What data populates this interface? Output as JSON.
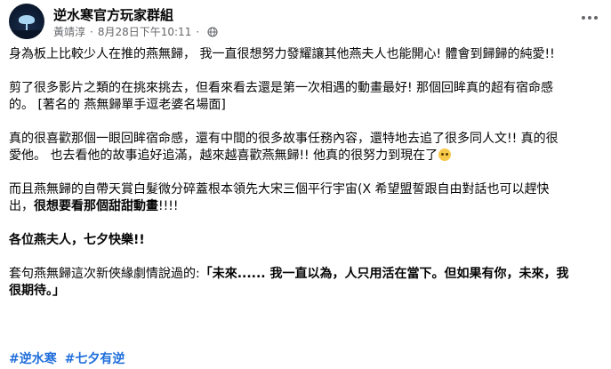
{
  "header": {
    "group_name": "逆水寒官方玩家群組",
    "author": "黃靖淳",
    "separator": "·",
    "timestamp": "8月28日下午10:11",
    "privacy_icon": "globe-icon",
    "more_icon": "more-horizontal-icon"
  },
  "post": {
    "p1": "身為板上比較少人在推的燕無歸， 我一直很想努力發耀讓其他燕夫人也能開心! 體會到歸歸的純愛!!",
    "p2_line1": "剪了很多影片之類的在挑來挑去，但看來看去還是第一次相遇的動畫最好! 那個回眸真的超有宿命感",
    "p2_line2": "的。 [著名的 燕無歸單手逗老婆名場面]",
    "p3_line1": "真的很喜歡那個一眼回眸宿命感，還有中間的很多故事任務內容，還特地去追了很多同人文!! 真的很",
    "p3_line2": "愛他。 也去看他的故事追好追滿，越來越喜歡燕無歸!! 他真的很努力到現在了",
    "p3_emoji": "pleading-face-emoji",
    "p4_line1": "而且燕無歸的自帶天賞白髮微分碎蓋根本領先大宋三個平行宇宙(X 希望盟誓跟自由對話也可以趕快",
    "p4_line2_normal": "出，",
    "p4_line2_bold": "很想要看那個甜甜動畫",
    "p4_line2_end": "!!!!",
    "p5": "各位燕夫人，七夕快樂!!",
    "p6_line1_normal": "套句燕無歸這次新俠緣劇情說過的:",
    "p6_line1_bold": "「未來...... 我一直以為，人只用活在當下。但如果有你，未來，我",
    "p6_line2_bold": "很期待。」"
  },
  "hashtags": [
    "#逆水寒",
    "#七夕有逆"
  ],
  "colors": {
    "text": "#050505",
    "meta": "#65676b",
    "link": "#216fdb"
  }
}
